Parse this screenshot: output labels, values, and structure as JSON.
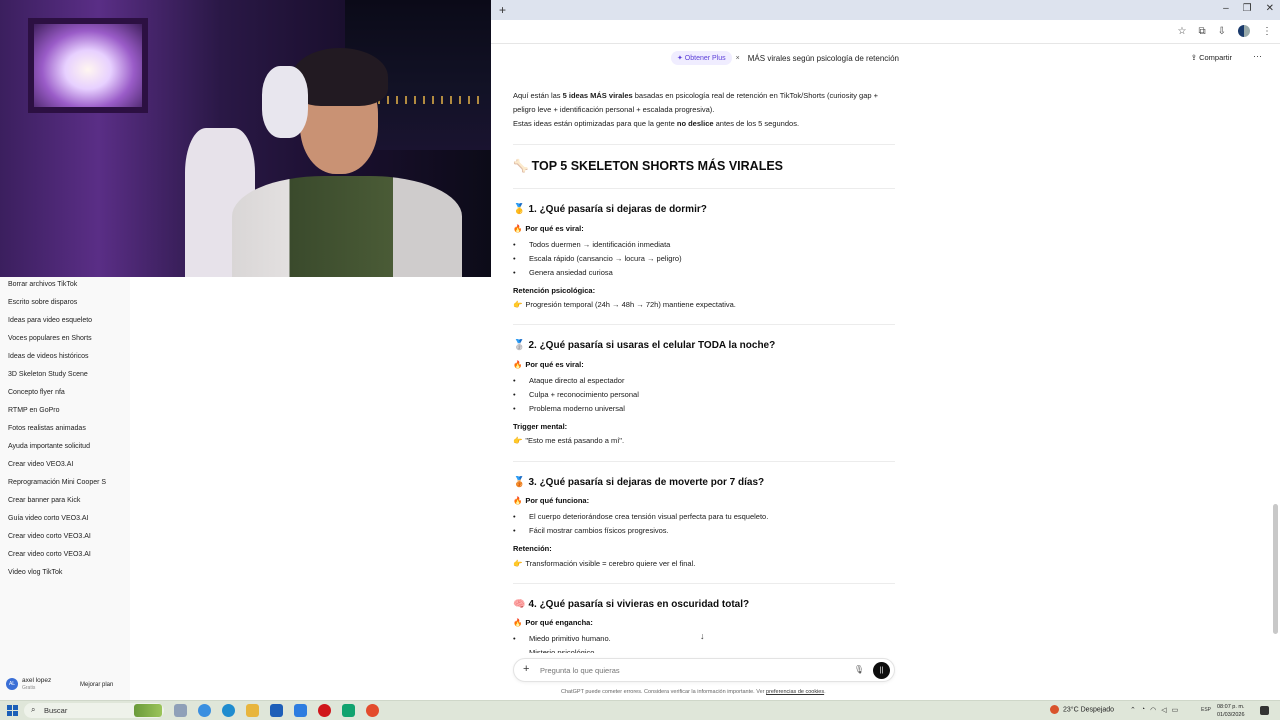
{
  "browser": {
    "new_tab": "+",
    "window_controls": [
      "–",
      "❐",
      "✕"
    ]
  },
  "sidebar": {
    "items": [
      "Borrar archivos TikTok",
      "Escrito sobre disparos",
      "Ideas para video esqueleto",
      "Voces populares en Shorts",
      "Ideas de videos históricos",
      "3D Skeleton Study Scene",
      "Concepto flyer nfa",
      "RTMP en GoPro",
      "Fotos realistas animadas",
      "Ayuda importante solicitud",
      "Crear video VEO3.AI",
      "Reprogramación Mini Cooper S",
      "Crear banner para Kick",
      "Guía video corto VEO3.AI",
      "Crear video corto VEO3.AI",
      "Crear video corto VEO3.AI",
      "Video vlog TikTok"
    ],
    "user": {
      "initials": "AL",
      "name": "axel lopez",
      "plan": "Gratis"
    },
    "upgrade_label": "Mejorar plan"
  },
  "header": {
    "plus_label": "✦ Obtener Plus",
    "close": "×",
    "chat_title": "MÁS virales según psicología de retención",
    "share_label": "Compartir",
    "more": "···"
  },
  "chat": {
    "intro_1a": "Aquí están las ",
    "intro_1b": "5 ideas MÁS virales",
    "intro_1c": " basadas en psicología real de retención en TikTok/Shorts (curiosity gap +",
    "intro_2": "peligro leve + identificación personal + escalada progresiva).",
    "intro_3a": "Estas ideas están optimizadas para que la gente ",
    "intro_3b": "no deslice",
    "intro_3c": " antes de los 5 segundos.",
    "heading_emoji": "🦴",
    "heading": "TOP 5 SKELETON SHORTS MÁS VIRALES",
    "ideas": [
      {
        "emoji": "🥇",
        "title": "1. ¿Qué pasaría si dejaras de dormir?",
        "why_label": "Por qué es viral:",
        "bullets": [
          "Todos duermen → identificación inmediata",
          "Escala rápido (cansancio → locura → peligro)",
          "Genera ansiedad curiosa"
        ],
        "sub_label": "Retención psicológica:",
        "sub_text": "Progresión temporal (24h → 48h → 72h) mantiene expectativa."
      },
      {
        "emoji": "🥈",
        "title": "2. ¿Qué pasaría si usaras el celular TODA la noche?",
        "why_label": "Por qué es viral:",
        "bullets": [
          "Ataque directo al espectador",
          "Culpa + reconocimiento personal",
          "Problema moderno universal"
        ],
        "sub_label": "Trigger mental:",
        "sub_text": "\"Esto me está pasando a mí\"."
      },
      {
        "emoji": "🥉",
        "title": "3. ¿Qué pasaría si dejaras de moverte por 7 días?",
        "why_label": "Por qué funciona:",
        "bullets": [
          "El cuerpo deteriorándose crea tensión visual perfecta para tu esqueleto.",
          "Fácil mostrar cambios físicos progresivos."
        ],
        "sub_label": "Retención:",
        "sub_text": "Transformación visible = cerebro quiere ver el final."
      },
      {
        "emoji": "🧠",
        "title": "4. ¿Qué pasaría si vivieras en oscuridad total?",
        "why_label": "Por qué engancha:",
        "bullets": [
          "Miedo primitivo humano.",
          "Misterio psicológico."
        ]
      }
    ],
    "fire_emoji": "🔥",
    "point_emoji": "👉",
    "scroll_down": "↓"
  },
  "composer": {
    "plus": "+",
    "placeholder": "Pregunta lo que quieras",
    "mic": "🎙",
    "voice": "||",
    "disclaimer_a": "ChatGPT puede cometer errores. Considera verificar la información importante. Ver ",
    "disclaimer_link": "preferencias de cookies",
    "disclaimer_b": "."
  },
  "taskbar": {
    "search_label": "Buscar",
    "weather": "23°C  Despejado",
    "lang": "ESP",
    "time": "08:07 p. m.",
    "date": "01/03/2026"
  }
}
